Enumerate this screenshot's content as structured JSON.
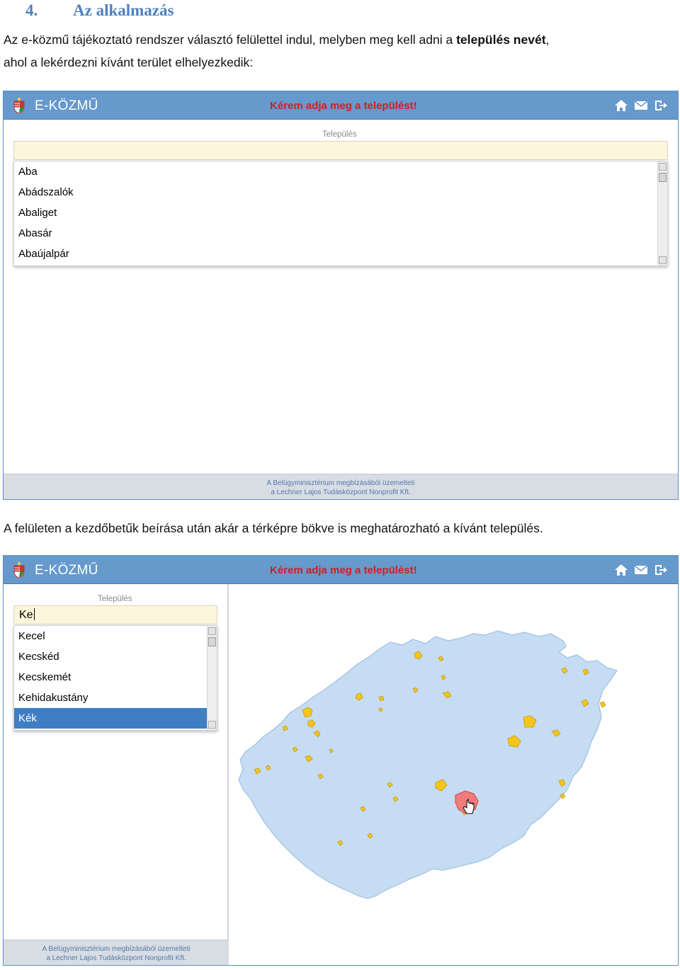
{
  "heading": {
    "number": "4.",
    "title": "Az alkalmazás"
  },
  "intro": {
    "line1_pre": "Az e-közmű tájékoztató rendszer választó felülettel indul, melyben meg kell adni a ",
    "line1_bold": "település nevét",
    "line1_post": ",",
    "line2": "ahol a lekérdezni kívánt terület elhelyezkedik:"
  },
  "caption2": "A felületen a kezdőbetűk beírása után akár a térképre bökve is meghatározható a kívánt település.",
  "app": {
    "brand": "E-KÖZMŰ",
    "prompt": "Kérem adja meg a települést!",
    "icons": [
      "home-icon",
      "mail-icon",
      "logout-icon"
    ],
    "field_label": "Település",
    "footer_line1": "A Belügyminisztérium megbízásából üzemelteti",
    "footer_line2": "a Lechner Lajos Tudásközpont Nonprofit Kft.",
    "colors": {
      "topbar": "#6699cc",
      "prompt": "#cc2222",
      "input_bg": "#fdf6dc",
      "selected": "#3f7ec4",
      "map_fill": "#c5dcf2",
      "marker": "#f5c518",
      "highlight": "#f07b7b"
    }
  },
  "screen1": {
    "input_value": "",
    "options": [
      "Aba",
      "Abádszalók",
      "Abaliget",
      "Abasár",
      "Abaújalpár"
    ]
  },
  "screen2": {
    "input_value": "Ke",
    "options": [
      "Kecel",
      "Kecskéd",
      "Kecskemét",
      "Kehidakustány",
      "Kék"
    ],
    "selected_index": 4
  }
}
